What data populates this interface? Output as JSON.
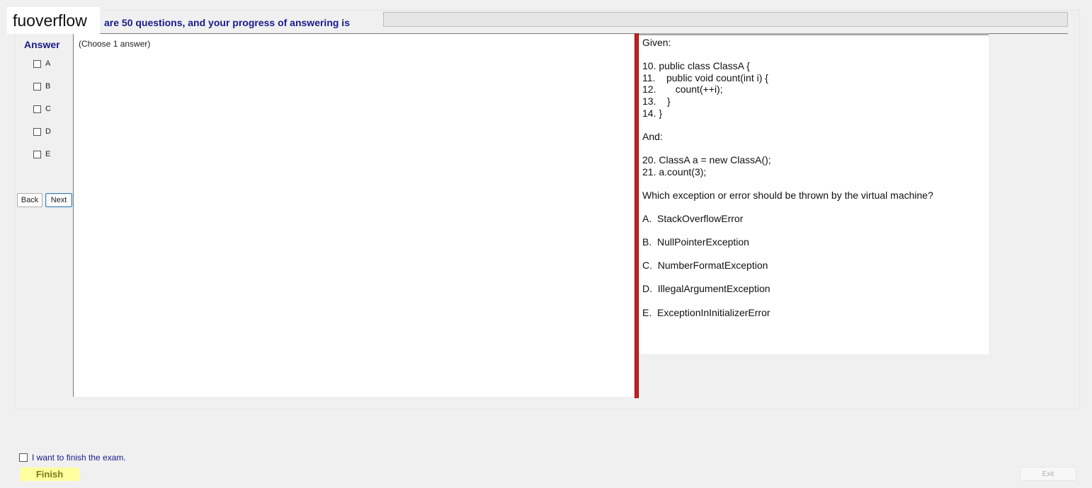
{
  "watermark": "fuoverflow",
  "header": {
    "progress_label": "are 50 questions, and your progress of answering is",
    "progress_fraction": 0
  },
  "answer_panel": {
    "title": "Answer",
    "options": [
      "A",
      "B",
      "C",
      "D",
      "E"
    ],
    "hint": "(Choose 1 answer)",
    "back_label": "Back",
    "next_label": "Next"
  },
  "question": {
    "lines": [
      "Given:",
      "",
      "10. public class ClassA {",
      "11.    public void count(int i) {",
      "12.       count(++i);",
      "13.    }",
      "14. }",
      "",
      "And:",
      "",
      "20. ClassA a = new ClassA();",
      "21. a.count(3);",
      "",
      "Which exception or error should be thrown by the virtual machine?",
      "",
      "A.  StackOverflowError",
      "",
      "B.  NullPointerException",
      "",
      "C.  NumberFormatException",
      "",
      "D.  IllegalArgumentException",
      "",
      "E.  ExceptionInInitializerError"
    ]
  },
  "footer": {
    "finish_checkbox_label": "I want to finish the exam.",
    "finish_label": "Finish",
    "exit_label": "Exit"
  },
  "colors": {
    "accent_text": "#1a1a8c",
    "splitter": "#cc1f1f",
    "finish_bg": "#ffffa0"
  }
}
